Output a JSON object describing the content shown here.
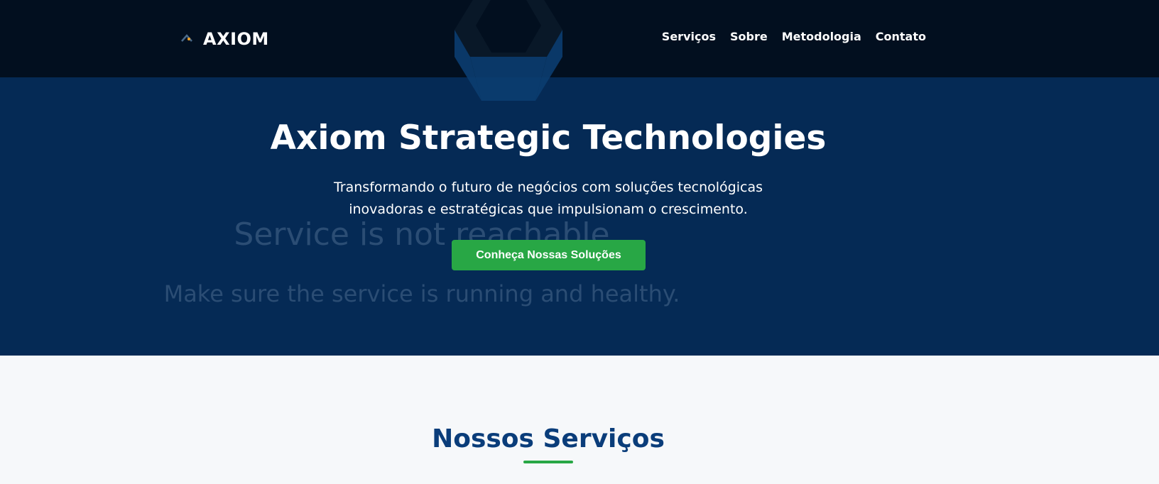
{
  "header": {
    "logo_text": "AXIOM",
    "nav": [
      {
        "label": "Serviços"
      },
      {
        "label": "Sobre"
      },
      {
        "label": "Metodologia"
      },
      {
        "label": "Contato"
      }
    ]
  },
  "hero": {
    "title": "Axiom Strategic Technologies",
    "subtitle_line1": "Transformando o futuro de negócios com soluções tecnológicas",
    "subtitle_line2": "inovadoras e estratégicas que impulsionam o crescimento.",
    "cta_label": "Conheça Nossas Soluções",
    "ghost_title": "Service is not reachable",
    "ghost_subtitle": "Make sure the service is running and healthy."
  },
  "services": {
    "title": "Nossos Serviços"
  },
  "colors": {
    "header_bg": "#020f1f",
    "hero_bg": "#052a55",
    "accent_green": "#28a745",
    "section_title": "#0a3d7a"
  }
}
